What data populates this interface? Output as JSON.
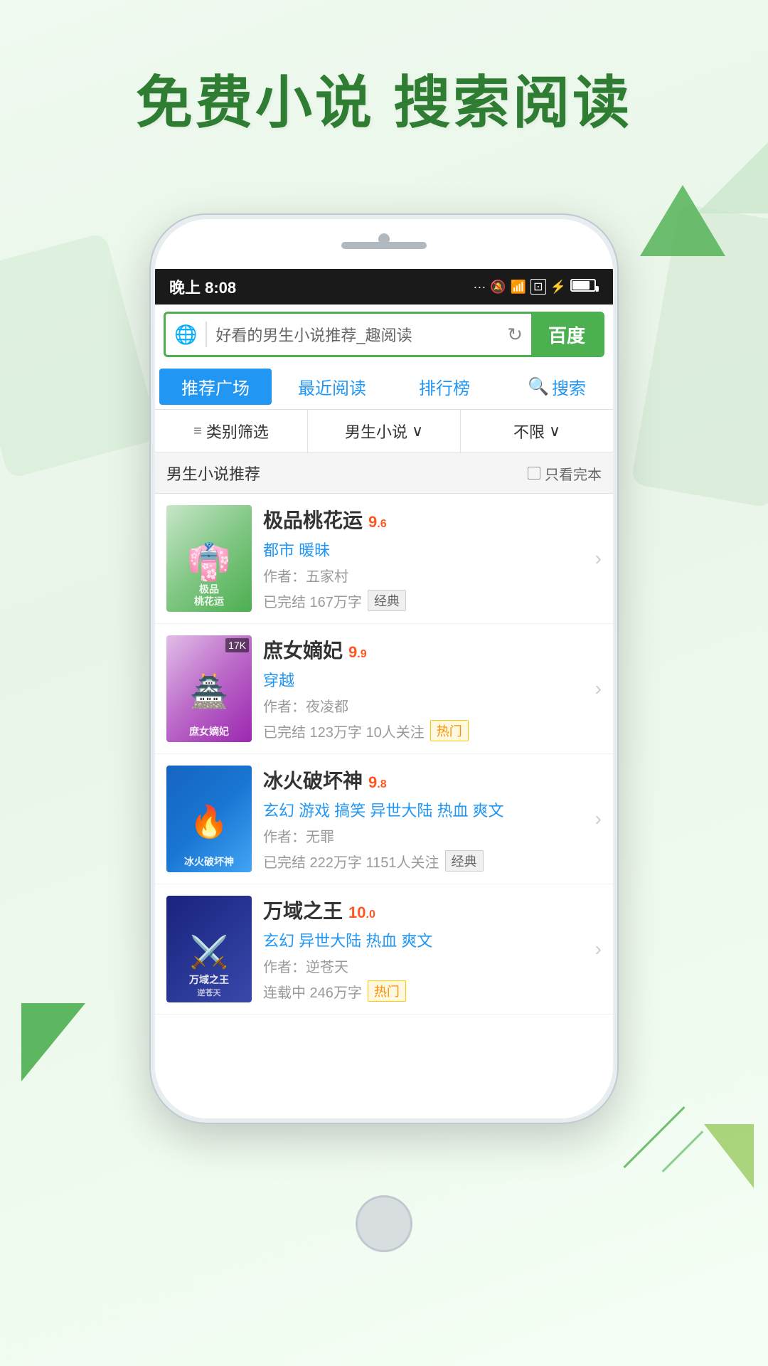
{
  "page": {
    "background_color": "#f0faf0",
    "headline": "免费小说  搜索阅读"
  },
  "status_bar": {
    "time": "晚上 8:08",
    "signal_dots": "···",
    "mute_icon": "🔔",
    "wifi_icon": "WiFi",
    "battery_icon": "🔋"
  },
  "search_bar": {
    "globe_symbol": "🌐",
    "search_text": "好看的男生小说推荐_趣阅读",
    "refresh_symbol": "↻",
    "button_label": "百度"
  },
  "tabs": [
    {
      "id": "recommend",
      "label": "推荐广场",
      "active": true
    },
    {
      "id": "recent",
      "label": "最近阅读",
      "active": false
    },
    {
      "id": "ranking",
      "label": "排行榜",
      "active": false
    },
    {
      "id": "search",
      "label": "搜索",
      "active": false,
      "has_icon": true
    }
  ],
  "filters": [
    {
      "id": "category",
      "label": "类别筛选",
      "icon": "≡"
    },
    {
      "id": "genre",
      "label": "男生小说",
      "suffix": "∨"
    },
    {
      "id": "limit",
      "label": "不限",
      "suffix": "∨"
    }
  ],
  "section": {
    "title": "男生小说推荐",
    "filter_label": "只看完本",
    "filter_checkbox": false
  },
  "books": [
    {
      "id": 1,
      "title": "极品桃花运",
      "rating": "9",
      "rating_decimal": ".6",
      "genre": "都市 暖昧",
      "author": "作者：五家村",
      "meta": "已完结 167万字",
      "tag": "经典",
      "tag_type": "classic",
      "cover_bg": "1",
      "cover_title": "极品\n桃花运",
      "cover_label": ""
    },
    {
      "id": 2,
      "title": "庶女嫡妃",
      "rating": "9",
      "rating_decimal": ".9",
      "genre": "穿越",
      "author": "作者：夜凌都",
      "meta": "已完结 123万字 10人关注",
      "tag": "热门",
      "tag_type": "hot",
      "cover_bg": "2",
      "cover_title": "庶女嫡妃",
      "cover_label": "17K"
    },
    {
      "id": 3,
      "title": "冰火破坏神",
      "rating": "9",
      "rating_decimal": ".8",
      "genre": "玄幻 游戏 搞笑 异世大陆 热血 爽文",
      "author": "作者：无罪",
      "meta": "已完结 222万字 1151人关注",
      "tag": "经典",
      "tag_type": "classic",
      "cover_bg": "3",
      "cover_title": "冰火破坏神",
      "cover_label": ""
    },
    {
      "id": 4,
      "title": "万域之王",
      "rating": "10",
      "rating_decimal": ".0",
      "genre": "玄幻 异世大陆 热血 爽文",
      "author": "作者：逆苍天",
      "meta": "连载中 246万字",
      "tag": "热门",
      "tag_type": "hot",
      "cover_bg": "4",
      "cover_title": "万域之王",
      "cover_label": ""
    }
  ]
}
